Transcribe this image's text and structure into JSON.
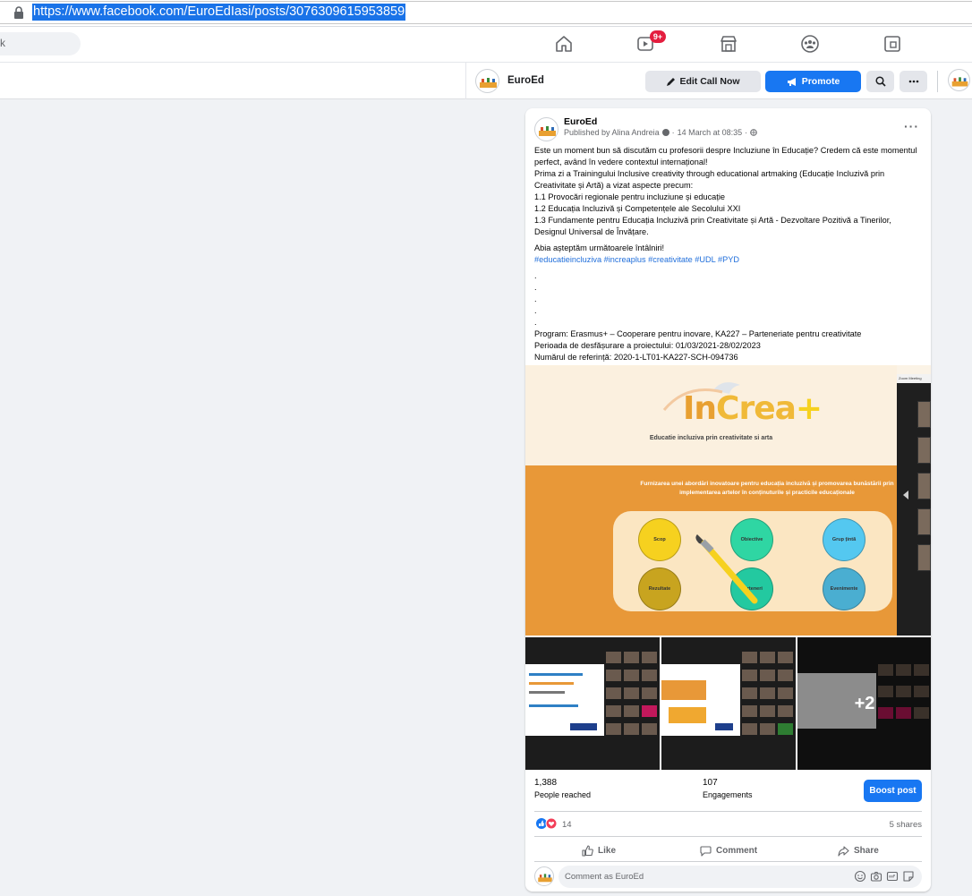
{
  "browser": {
    "url": "https://www.facebook.com/EuroEdIasi/posts/3076309615953859"
  },
  "nav": {
    "search_fragment": "k",
    "video_badge": "9+",
    "icons": [
      "home-icon",
      "watch-icon",
      "marketplace-icon",
      "groups-icon",
      "gaming-icon"
    ]
  },
  "page_bar": {
    "page_name": "EuroEd",
    "edit_call_now": "Edit Call Now",
    "promote": "Promote"
  },
  "post": {
    "author": "EuroEd",
    "published_by": "Published by Alina Andreia",
    "date": "14 March at 08:35",
    "separator": "·",
    "body_main": "Este un moment bun să discutăm cu profesorii despre Incluziune în Educație? Credem că este momentul perfect, având în vedere contextul internațional!\nPrima zi a Trainingului Inclusive creativity through educational artmaking (Educație Incluzivă prin Creativitate și Artă) a vizat aspecte precum:\n1.1 Provocări regionale pentru incluziune și educație\n1.2 Educația Incluzivă și Competențele ale Secolului XXI\n1.3 Fundamente pentru Educația Incluzivă prin Creativitate și Artă - Dezvoltare Pozitivă a Tinerilor, Designul Universal de Învățare.",
    "closing": "Abia așteptăm următoarele întâlniri!",
    "hashtags": "#educatieincluziva #increaplus #creativitate #UDL #PYD",
    "dots": ".\n.\n.\n.\n.",
    "program": "Program: Erasmus+ – Cooperare pentru inovare, KA227 – Parteneriate pentru creativitate\nPerioada de desfășurare a proiectului: 01/03/2021-28/02/2023\nNumărul de referință: 2020-1-LT01-KA227-SCH-094736"
  },
  "slide": {
    "logo_in": "In",
    "logo_crea": "Crea",
    "logo_plus": "+",
    "subtitle": "Educatie incluziva prin creativitate si arta",
    "heading": "Furnizarea unei abordări inovatoare pentru educația incluzivă și promovarea bunăstării prin implementarea artelor în conținuturile și practicile educaționale",
    "circles": [
      {
        "label": "Scop",
        "color": "#f6d11f"
      },
      {
        "label": "Obiective",
        "color": "#2fd6a3"
      },
      {
        "label": "Grup țintă",
        "color": "#54c8f0"
      },
      {
        "label": "Rezultate",
        "color": "#c8a41f"
      },
      {
        "label": "Parteneri",
        "color": "#23c9a0"
      },
      {
        "label": "Evenimente",
        "color": "#4aaed1"
      }
    ],
    "zoom_title": "Zoom Meeting"
  },
  "thumbnails": {
    "more_count": "+2"
  },
  "insights": {
    "reached_value": "1,388",
    "reached_label": "People reached",
    "engagements_value": "107",
    "engagements_label": "Engagements",
    "boost_label": "Boost post"
  },
  "reactions": {
    "count": "14",
    "shares": "5 shares"
  },
  "actions": {
    "like": "Like",
    "comment": "Comment",
    "share": "Share"
  },
  "comment": {
    "placeholder": "Comment as EuroEd"
  },
  "colors": {
    "fb_blue": "#1877f2",
    "slide_orange": "#e89838"
  }
}
